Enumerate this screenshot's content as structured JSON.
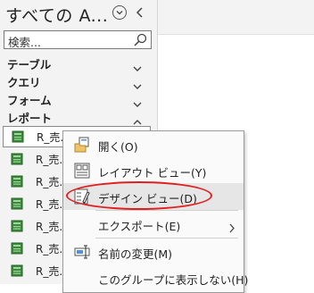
{
  "nav": {
    "title": "すべての A...",
    "search_placeholder": "検索...",
    "groups": [
      {
        "label": "テーブル",
        "state": "collapsed"
      },
      {
        "label": "クエリ",
        "state": "collapsed"
      },
      {
        "label": "フォーム",
        "state": "collapsed"
      },
      {
        "label": "レポート",
        "state": "expanded"
      }
    ],
    "report_items": [
      {
        "label": "R_売..."
      },
      {
        "label": "R_売..."
      },
      {
        "label": "R_売..."
      },
      {
        "label": "R_売..."
      },
      {
        "label": "R_売..."
      },
      {
        "label": "R_売..."
      },
      {
        "label": "R_売..."
      }
    ]
  },
  "context_menu": {
    "items": [
      {
        "label": "開く(O)",
        "icon": "open-icon"
      },
      {
        "label": "レイアウト ビュー(Y)",
        "icon": "layout-view-icon"
      },
      {
        "label": "デザイン ビュー(D)",
        "icon": "design-view-icon"
      },
      {
        "label": "エクスポート(E)",
        "icon": "",
        "submenu": true
      },
      {
        "label": "名前の変更(M)",
        "icon": "rename-icon"
      },
      {
        "label": "このグループに表示しない(H)",
        "icon": ""
      }
    ],
    "highlighted": "デザイン ビュー(D)"
  },
  "colors": {
    "annotation": "#e02020",
    "report_icon": "#3a8a3a",
    "highlight": "#e6e6e6"
  }
}
